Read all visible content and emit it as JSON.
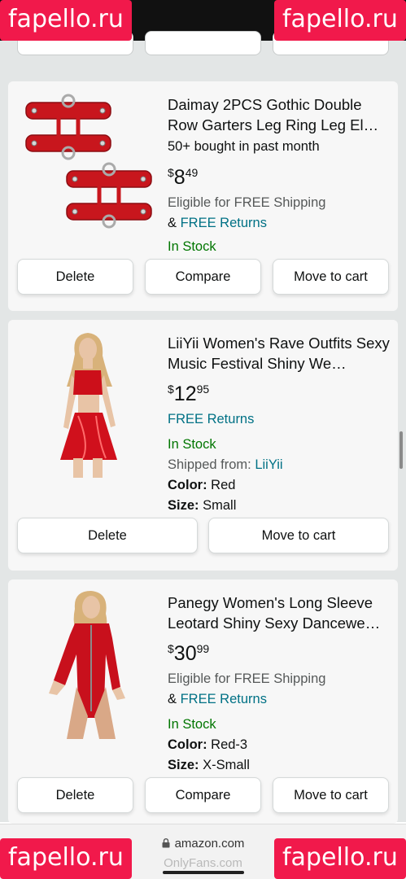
{
  "watermark": {
    "brand": "fapello.ru",
    "footer_text": "OnlyFans.com"
  },
  "browser": {
    "url": "amazon.com"
  },
  "colors": {
    "accent_link": "#007185",
    "in_stock": "#007600",
    "brand_bg": "#f1194b"
  },
  "items": [
    {
      "title": "Daimay 2PCS Gothic Double Row Garters Leg Ring Leg El…",
      "bought": "50+ bought in past month",
      "price_symbol": "$",
      "price_whole": "8",
      "price_cents": "49",
      "shipping": "Eligible for FREE Shipping",
      "returns_prefix": "& ",
      "returns": "FREE Returns",
      "stock": "In Stock",
      "buttons": {
        "delete": "Delete",
        "compare": "Compare",
        "move": "Move to cart"
      }
    },
    {
      "title": "LiiYii Women's Rave Outfits Sexy Music Festival Shiny We…",
      "price_symbol": "$",
      "price_whole": "12",
      "price_cents": "95",
      "returns": "FREE Returns",
      "stock": "In Stock",
      "shipped_from_label": "Shipped from: ",
      "shipped_from_value": "LiiYii",
      "color_label": "Color:",
      "color_value": " Red",
      "size_label": "Size:",
      "size_value": " Small",
      "buttons": {
        "delete": "Delete",
        "move": "Move to cart"
      }
    },
    {
      "title": "Panegy Women's Long Sleeve Leotard Shiny Sexy Dancewe…",
      "price_symbol": "$",
      "price_whole": "30",
      "price_cents": "99",
      "shipping": "Eligible for FREE Shipping",
      "returns_prefix": "& ",
      "returns": "FREE Returns",
      "stock": "In Stock",
      "color_label": "Color:",
      "color_value": " Red-3",
      "size_label": "Size:",
      "size_value": " X-Small",
      "buttons": {
        "delete": "Delete",
        "compare": "Compare",
        "move": "Move to cart"
      }
    }
  ]
}
